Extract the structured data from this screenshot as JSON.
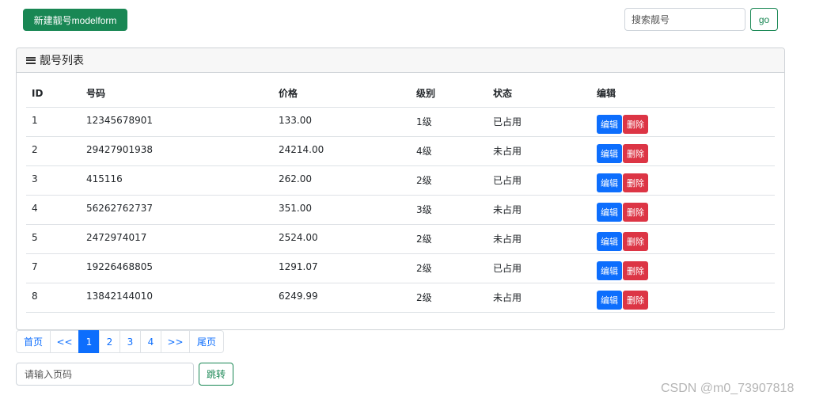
{
  "toolbar": {
    "new_label": "新建靓号modelform",
    "search_placeholder": "搜索靓号",
    "go_label": "go"
  },
  "panel": {
    "title": "靓号列表"
  },
  "table": {
    "headers": [
      "ID",
      "号码",
      "价格",
      "级别",
      "状态",
      "编辑"
    ],
    "edit_label": "编辑",
    "delete_label": "删除",
    "rows": [
      {
        "id": "1",
        "mobile": "12345678901",
        "price": "133.00",
        "level": "1级",
        "status": "已占用"
      },
      {
        "id": "2",
        "mobile": "29427901938",
        "price": "24214.00",
        "level": "4级",
        "status": "未占用"
      },
      {
        "id": "3",
        "mobile": "415116",
        "price": "262.00",
        "level": "2级",
        "status": "已占用"
      },
      {
        "id": "4",
        "mobile": "56262762737",
        "price": "351.00",
        "level": "3级",
        "status": "未占用"
      },
      {
        "id": "5",
        "mobile": "2472974017",
        "price": "2524.00",
        "level": "2级",
        "status": "未占用"
      },
      {
        "id": "7",
        "mobile": "19226468805",
        "price": "1291.07",
        "level": "2级",
        "status": "已占用"
      },
      {
        "id": "8",
        "mobile": "13842144010",
        "price": "6249.99",
        "level": "2级",
        "status": "未占用"
      }
    ]
  },
  "pagination": {
    "items": [
      {
        "label": "首页",
        "active": false
      },
      {
        "label": "<<",
        "active": false
      },
      {
        "label": "1",
        "active": true
      },
      {
        "label": "2",
        "active": false
      },
      {
        "label": "3",
        "active": false
      },
      {
        "label": "4",
        "active": false
      },
      {
        "label": ">>",
        "active": false
      },
      {
        "label": "尾页",
        "active": false
      }
    ],
    "page_input_placeholder": "请输入页码",
    "jump_label": "跳转"
  },
  "watermark": "CSDN @m0_73907818",
  "colors": {
    "primary": "#0d6efd",
    "success": "#198754",
    "danger": "#dc3545"
  }
}
